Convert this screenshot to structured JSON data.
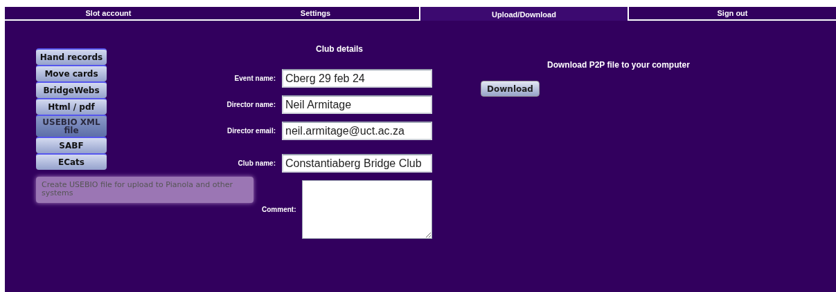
{
  "tabs": [
    {
      "label": "Slot account",
      "selected": false
    },
    {
      "label": "Settings",
      "selected": false
    },
    {
      "label": "Upload/Download",
      "selected": true
    },
    {
      "label": "Sign out",
      "selected": false
    }
  ],
  "sidebar": {
    "items": [
      {
        "label": "Hand records",
        "selected": false
      },
      {
        "label": "Move cards",
        "selected": false
      },
      {
        "label": "BridgeWebs",
        "selected": false
      },
      {
        "label": "Html / pdf",
        "selected": false
      },
      {
        "label": "USEBIO XML file",
        "selected": true
      },
      {
        "label": "SABF",
        "selected": false
      },
      {
        "label": "ECats",
        "selected": false
      }
    ],
    "tooltip": "Create USEBIO file for upload to Pianola and other systems"
  },
  "form": {
    "title": "Club details",
    "fields": [
      {
        "kind": "input",
        "label": "Event name:",
        "value": "Cberg 29 feb 24"
      },
      {
        "kind": "input",
        "label": "Director name:",
        "value": "Neil Armitage"
      },
      {
        "kind": "input",
        "label": "Director email:",
        "value": "neil.armitage@uct.ac.za"
      },
      {
        "kind": "input",
        "label": "Club name:",
        "value": "Constantiaberg Bridge Club"
      },
      {
        "kind": "textarea",
        "label": "Comment:"
      }
    ]
  },
  "download": {
    "title": "Download P2P file to your computer",
    "button": "Download"
  }
}
